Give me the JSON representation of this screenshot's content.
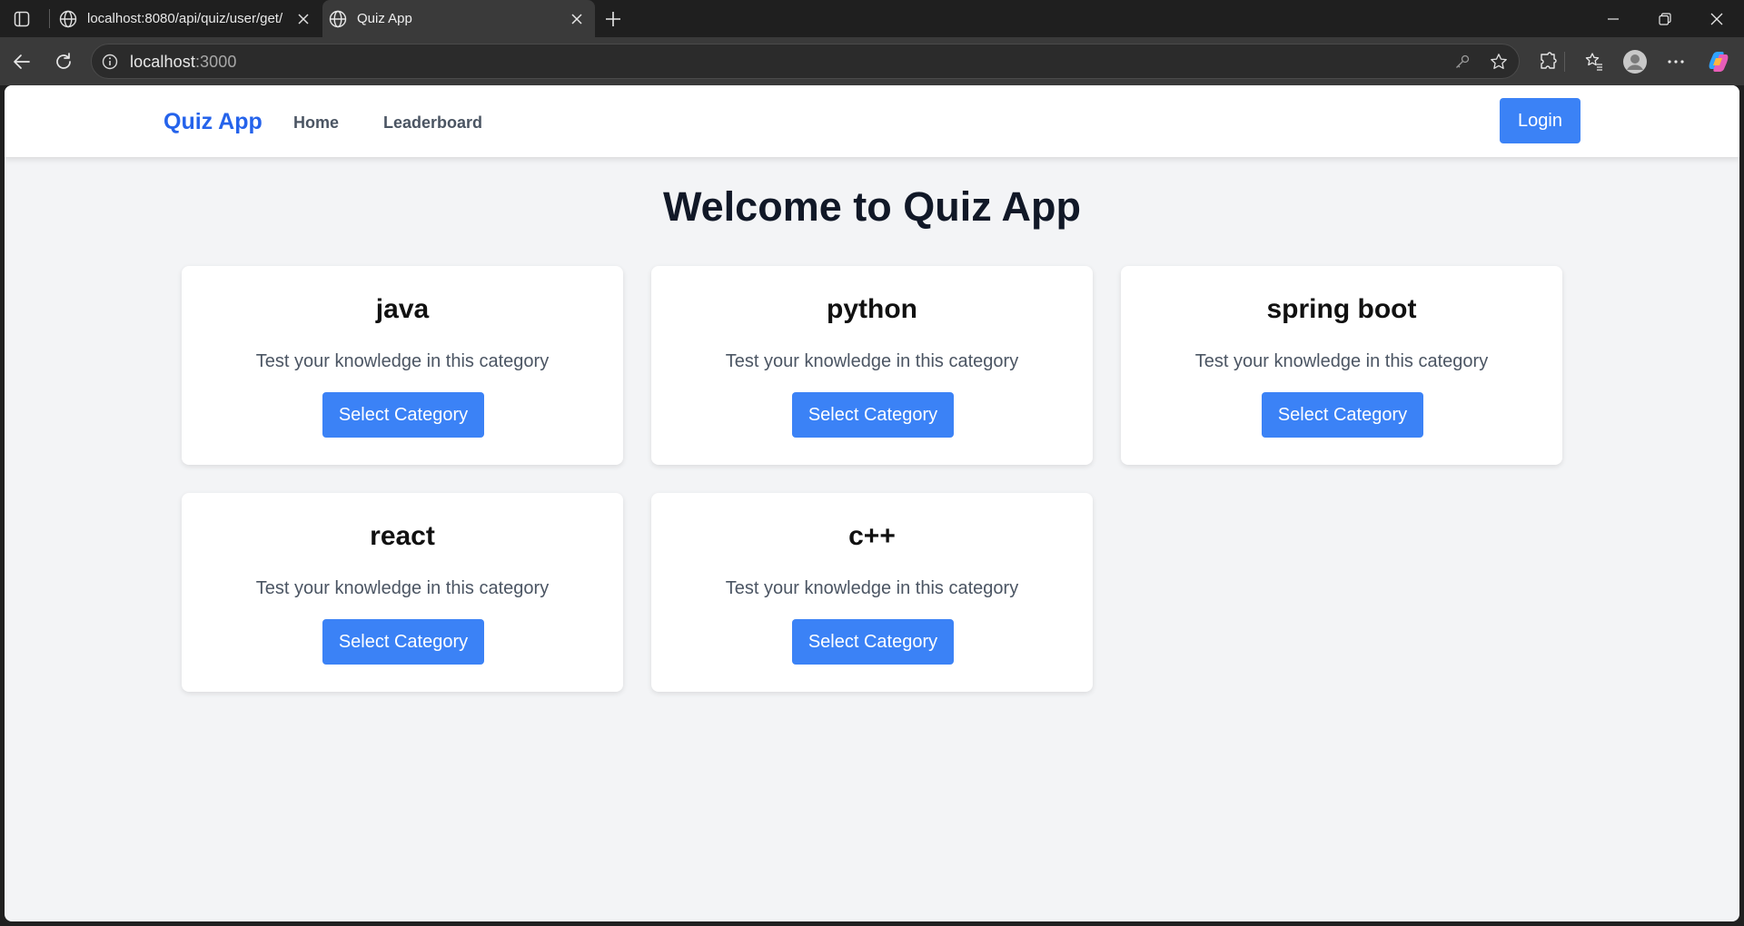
{
  "browser": {
    "tabs": [
      {
        "title": "localhost:8080/api/quiz/user/get/",
        "active": false
      },
      {
        "title": "Quiz App",
        "active": true
      }
    ],
    "address": {
      "host": "localhost",
      "port": ":3000"
    }
  },
  "navbar": {
    "brand": "Quiz App",
    "links": [
      "Home",
      "Leaderboard"
    ],
    "login_label": "Login"
  },
  "main": {
    "title": "Welcome to Quiz App",
    "categories": [
      {
        "name": "java",
        "description": "Test your knowledge in this category",
        "button": "Select Category"
      },
      {
        "name": "python",
        "description": "Test your knowledge in this category",
        "button": "Select Category"
      },
      {
        "name": "spring boot",
        "description": "Test your knowledge in this category",
        "button": "Select Category"
      },
      {
        "name": "react",
        "description": "Test your knowledge in this category",
        "button": "Select Category"
      },
      {
        "name": "c++",
        "description": "Test your knowledge in this category",
        "button": "Select Category"
      }
    ]
  },
  "colors": {
    "brand": "#2563eb",
    "button": "#3b82f6",
    "page_bg": "#f3f4f6"
  },
  "icons": {
    "tab_favicon": "globe-icon",
    "toolbar": [
      "back-icon",
      "refresh-icon",
      "info-icon",
      "key-icon",
      "star-icon",
      "extensions-icon",
      "favorites-icon",
      "profile-icon",
      "more-icon",
      "copilot-icon"
    ]
  }
}
